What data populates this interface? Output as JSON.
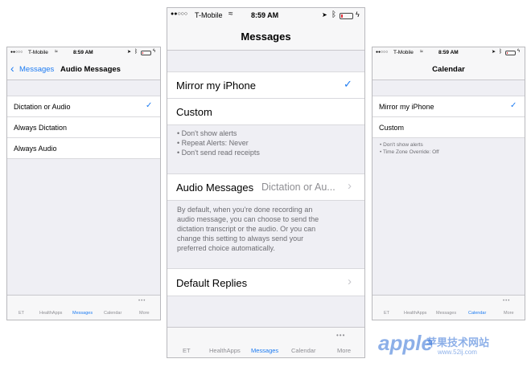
{
  "status": {
    "carrier": "T-Mobile",
    "signal": "●●○○○",
    "time": "8:59 AM",
    "wifi_icon": "wifi-icon",
    "location_icon": "location-arrow-icon",
    "bluetooth_icon": "bluetooth-icon",
    "battery_level": 0.15
  },
  "colors": {
    "accent": "#1e7cf2",
    "battery_low": "#e0303a"
  },
  "left": {
    "back_label": "Messages",
    "title": "Audio Messages",
    "options": [
      {
        "label": "Dictation or Audio",
        "checked": true
      },
      {
        "label": "Always Dictation",
        "checked": false
      },
      {
        "label": "Always Audio",
        "checked": false
      }
    ]
  },
  "center": {
    "title": "Messages",
    "mirror_label": "Mirror my iPhone",
    "custom_label": "Custom",
    "custom_notes": [
      "• Don't show alerts",
      "• Repeat Alerts: Never",
      "• Don't send read receipts"
    ],
    "audio_label": "Audio Messages",
    "audio_value": "Dictation or Au...",
    "audio_description": [
      "By default, when you're done recording an",
      "audio message, you can choose to send the",
      "dictation transcript or the audio. Or you can",
      "change this setting to always send your",
      "preferred choice automatically."
    ],
    "default_replies_label": "Default Replies"
  },
  "right": {
    "title": "Calendar",
    "mirror_label": "Mirror my iPhone",
    "custom_label": "Custom",
    "custom_notes": [
      "• Don't show alerts",
      "• Time Zone Override: Off"
    ]
  },
  "tabs": {
    "left_active": "Messages",
    "center_active": "Messages",
    "right_active": "Calendar",
    "items": [
      "ET",
      "HealthApps",
      "Messages",
      "Calendar",
      "More"
    ],
    "more_dots": "•••"
  },
  "watermark": {
    "brand": "apple",
    "site": "苹果技术网站",
    "url": "www.52ij.com"
  }
}
